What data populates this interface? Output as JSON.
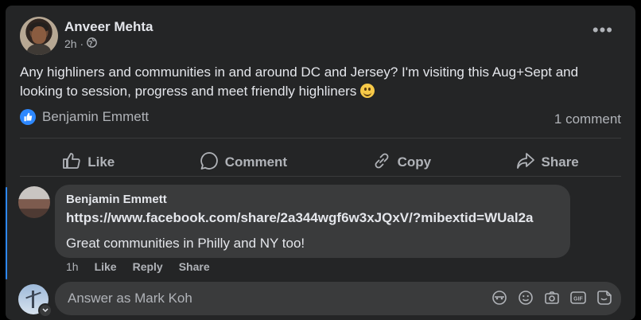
{
  "post": {
    "author": "Anveer Mehta",
    "time": "2h ·",
    "text": "Any highliners and communities in and around DC and Jersey? I'm visiting this Aug+Sept and looking to session, progress and meet friendly highliners",
    "reactor": "Benjamin Emmett",
    "comment_count": "1 comment"
  },
  "actions": {
    "like": "Like",
    "comment": "Comment",
    "copy": "Copy",
    "share": "Share"
  },
  "comment": {
    "author": "Benjamin Emmett",
    "link": "https://www.facebook.com/share/2a344wgf6w3xJQxV/?mibextid=WUal2a",
    "text": "Great communities in Philly and NY too!",
    "time": "1h",
    "like": "Like",
    "reply": "Reply",
    "share": "Share"
  },
  "reply_box": {
    "placeholder": "Answer as Mark Koh"
  },
  "icons": [
    "globe-icon",
    "more-icon",
    "like-icon",
    "comment-icon",
    "copy-icon",
    "share-icon",
    "avatar-icon",
    "emoji-icon",
    "camera-icon",
    "gif-icon",
    "sticker-icon"
  ],
  "colors": {
    "card": "#242526",
    "bubble": "#3a3b3c",
    "accent": "#2d88ff",
    "text": "#e4e6eb",
    "muted": "#b0b3b8"
  }
}
